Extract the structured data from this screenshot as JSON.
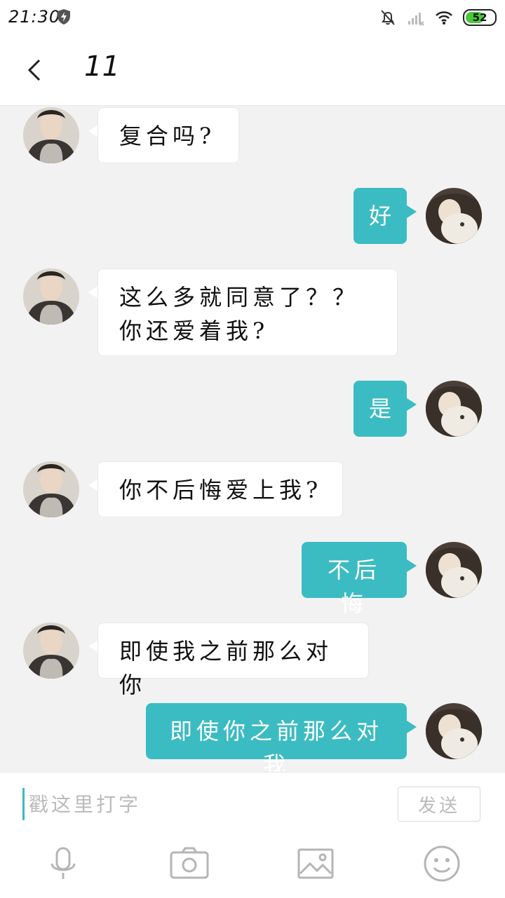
{
  "status_bar": {
    "time": "21:30",
    "battery": "52"
  },
  "header": {
    "title": "11"
  },
  "messages": [
    {
      "side": "in",
      "text": "复合吗?"
    },
    {
      "side": "out",
      "text": "好"
    },
    {
      "side": "in",
      "text": "这么多就同意了？？你还爱着我?"
    },
    {
      "side": "out",
      "text": "是"
    },
    {
      "side": "in",
      "text": "你不后悔爱上我?"
    },
    {
      "side": "out",
      "text": "不后悔"
    },
    {
      "side": "in",
      "text": "即使我之前那么对你"
    },
    {
      "side": "out",
      "text": "即使你之前那么对我"
    }
  ],
  "input": {
    "placeholder": "戳这里打字",
    "send_label": "发送"
  },
  "toolbar": {
    "icons": [
      "microphone-icon",
      "camera-icon",
      "image-icon",
      "emoji-icon"
    ]
  },
  "colors": {
    "accent": "#3bbcc2",
    "background": "#f2f2f2"
  }
}
